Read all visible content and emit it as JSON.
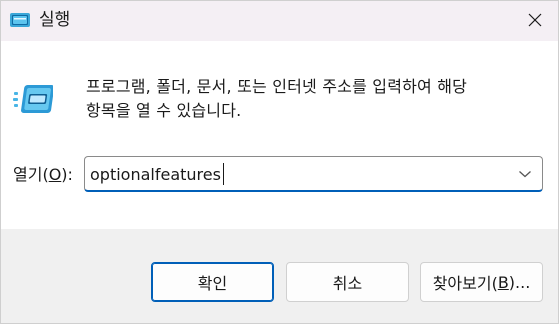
{
  "window": {
    "title": "실행",
    "close_icon": "close-icon"
  },
  "content": {
    "description_line1": "프로그램, 폴더, 문서, 또는 인터넷 주소를 입력하여 해당",
    "description_line2": "항목을 열 수 있습니다.",
    "open_label_prefix": "열기(",
    "open_label_key": "O",
    "open_label_suffix": "):",
    "command_value": "optionalfeatures",
    "dropdown_icon": "chevron-down-icon"
  },
  "buttons": {
    "ok_label": "확인",
    "cancel_label": "취소",
    "browse_prefix": "찾아보기(",
    "browse_key": "B",
    "browse_suffix": ")..."
  },
  "colors": {
    "titlebar": "#f4eff4",
    "footer": "#f0f0f0",
    "accent": "#005fb8"
  }
}
